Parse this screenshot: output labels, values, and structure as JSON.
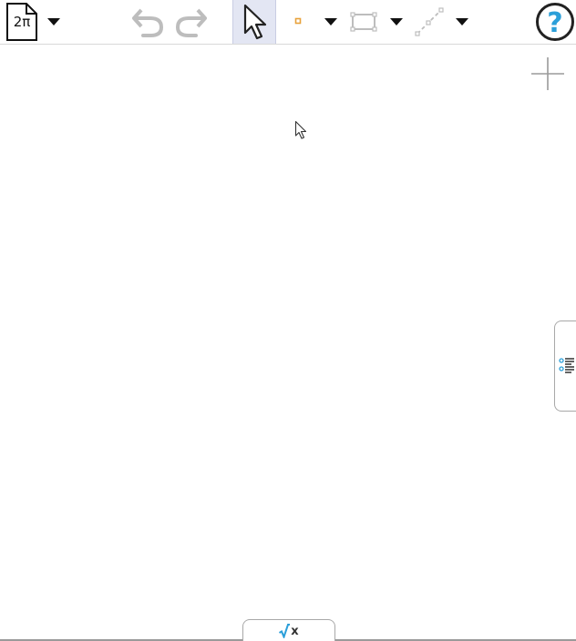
{
  "toolbar": {
    "file_button": {
      "label": "2π",
      "icon": "file-icon"
    },
    "tools": [
      {
        "name": "menu-dropdown",
        "icon": "caret-down-icon"
      },
      {
        "name": "undo",
        "icon": "undo-icon",
        "enabled": false
      },
      {
        "name": "redo",
        "icon": "redo-icon",
        "enabled": false
      },
      {
        "name": "move",
        "icon": "arrow-cursor-icon",
        "selected": true
      },
      {
        "name": "point",
        "icon": "point-icon"
      },
      {
        "name": "polygon",
        "icon": "polygon-icon"
      },
      {
        "name": "segment",
        "icon": "segment-icon"
      },
      {
        "name": "help",
        "icon": "help-icon"
      }
    ],
    "help_label": "?"
  },
  "canvas": {
    "zoom_icon": "plus-icon",
    "cursor_icon": "mouse-pointer-icon"
  },
  "side_panel_tab": {
    "icon": "algebra-list-icon"
  },
  "input_bar_tab": {
    "label": "x",
    "icon": "sqrt-icon"
  },
  "colors": {
    "accent_blue": "#2b9fd9",
    "point_orange": "#e8a23b",
    "selected_bg": "#e3e6f3",
    "disabled_gray": "#bdbdbd",
    "icon_dark": "#222222"
  }
}
